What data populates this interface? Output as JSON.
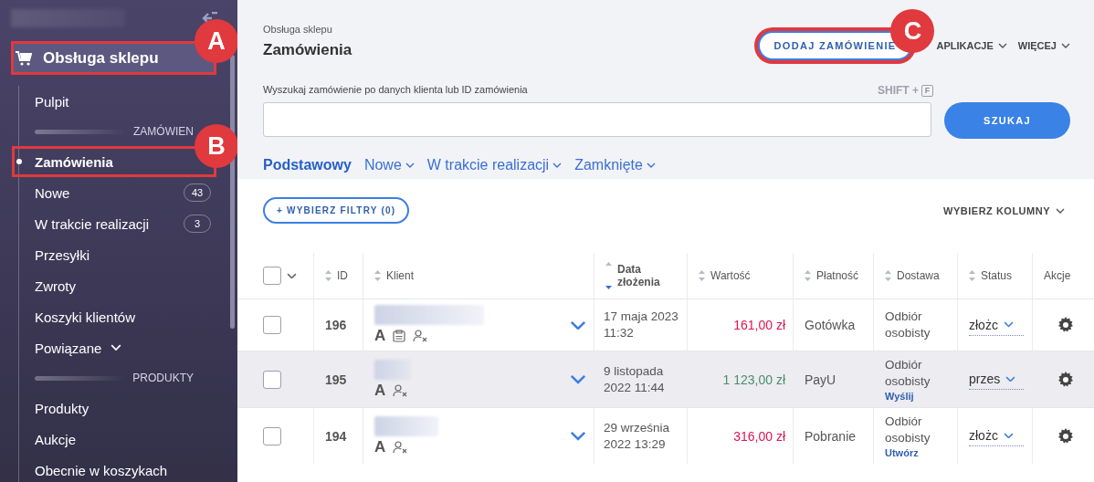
{
  "sidebar": {
    "section": {
      "label": "Obsługa sklepu",
      "selected": true,
      "callout": "A"
    },
    "items": [
      {
        "kind": "link",
        "label": "Pulpit",
        "selected": false
      },
      {
        "kind": "heading",
        "label": "ZAMÓWIEN"
      },
      {
        "kind": "link",
        "label": "Zamówienia",
        "selected": true,
        "callout": "B"
      },
      {
        "kind": "link",
        "label": "Nowe",
        "selected": false,
        "count": "43"
      },
      {
        "kind": "link",
        "label": "W trakcie realizacji",
        "selected": false,
        "count": "3"
      },
      {
        "kind": "link",
        "label": "Przesyłki",
        "selected": false
      },
      {
        "kind": "link",
        "label": "Zwroty",
        "selected": false
      },
      {
        "kind": "link",
        "label": "Koszyki klientów",
        "selected": false
      },
      {
        "kind": "menu",
        "label": "Powiązane",
        "selected": false
      },
      {
        "kind": "heading",
        "label": "PRODUKTY"
      },
      {
        "kind": "link",
        "label": "Produkty",
        "selected": false
      },
      {
        "kind": "link",
        "label": "Aukcje",
        "selected": false
      },
      {
        "kind": "link",
        "label": "Obecnie w koszykach",
        "selected": false
      }
    ]
  },
  "header": {
    "breadcrumb": "Obsługa sklepu",
    "title": "Zamówienia",
    "actions": [
      {
        "kind": "button",
        "label": "DODAJ ZAMÓWIENIE",
        "callout": "C"
      },
      {
        "kind": "menu",
        "label": "APLIKACJE"
      },
      {
        "kind": "menu",
        "label": "WIĘCEJ"
      }
    ]
  },
  "search": {
    "label": "Wyszukaj zamówienie po danych klienta lub ID zamówienia",
    "shortcut": "SHIFT +",
    "shortcut_key": "F",
    "button": "SZUKAJ"
  },
  "tabs": [
    {
      "label": "Podstawowy",
      "selected": true,
      "has_menu": false
    },
    {
      "label": "Nowe",
      "selected": false,
      "has_menu": true
    },
    {
      "label": "W trakcie realizacji",
      "selected": false,
      "has_menu": true
    },
    {
      "label": "Zamknięte",
      "selected": false,
      "has_menu": true
    }
  ],
  "toolbar": {
    "filters": "+ WYBIERZ FILTRY (0)",
    "columns": "WYBIERZ KOLUMNY"
  },
  "table": {
    "select_all": {
      "checked": false
    },
    "columns": [
      {
        "label": "ID",
        "sortable": true,
        "sorted_desc": false
      },
      {
        "label": "Klient",
        "sortable": true,
        "sorted_desc": false
      },
      {
        "label": "Data złożenia",
        "sortable": true,
        "sorted_desc": true
      },
      {
        "label": "Wartość",
        "sortable": true,
        "sorted_desc": false
      },
      {
        "label": "Płatność",
        "sortable": true,
        "sorted_desc": false
      },
      {
        "label": "Dostawa",
        "sortable": true,
        "sorted_desc": false
      },
      {
        "label": "Status",
        "sortable": true,
        "sorted_desc": false
      },
      {
        "label": "Akcje",
        "sortable": false,
        "sorted_desc": false
      }
    ],
    "rows": [
      {
        "checked": false,
        "highlighted": false,
        "id": "196",
        "client_mark": "A",
        "has_note": true,
        "guest": true,
        "date": [
          "17 maja 2023",
          "11:32"
        ],
        "value": "161,00 zł",
        "color": "#e0134f",
        "payment": "Gotówka",
        "delivery": "Odbiór osobisty",
        "status": "złożc"
      },
      {
        "checked": false,
        "highlighted": true,
        "id": "195",
        "client_mark": "A",
        "has_note": false,
        "guest": true,
        "date": [
          "9 listopada",
          "2022 11:44"
        ],
        "value": "1 123,00 zł",
        "color": "#4a8f6a",
        "payment": "PayU",
        "delivery": "Odbiór osobisty",
        "delivery_action": "Wyślij",
        "status": "przes"
      },
      {
        "checked": false,
        "highlighted": false,
        "id": "194",
        "client_mark": "A",
        "has_note": false,
        "guest": true,
        "date": [
          "29 września",
          "2022 13:29"
        ],
        "value": "316,00 zł",
        "color": "#e0134f",
        "payment": "Pobranie",
        "delivery": "Odbiór osobisty",
        "delivery_action": "Utwórz",
        "status": "złożc"
      }
    ]
  }
}
